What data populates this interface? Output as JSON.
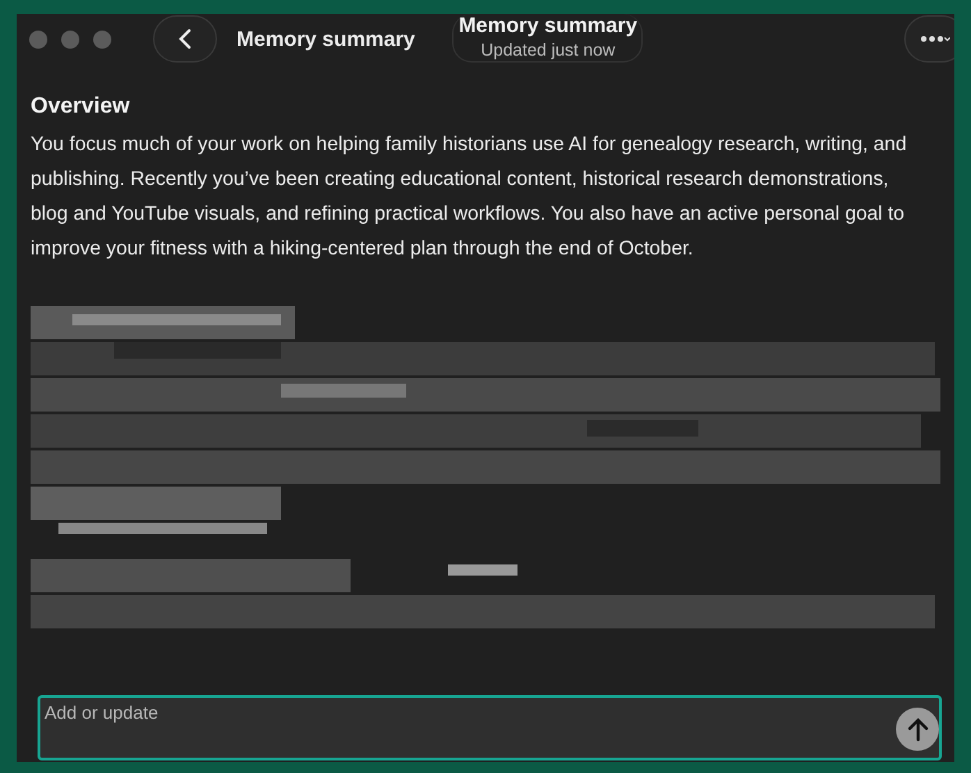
{
  "window": {
    "title": "Memory summary"
  },
  "header": {
    "title": "Memory summary",
    "subtitle": "Updated just now"
  },
  "overview": {
    "heading": "Overview",
    "text": "You focus much of your work on helping family historians use AI for genealogy research, writing, and publishing. Recently you’ve been creating educational content, historical research demonstrations, blog and YouTube visuals, and refining practical workflows. You also have an active personal goal to improve your fitness with a hiking-centered plan through the end of October."
  },
  "composer": {
    "placeholder": "Add or update"
  }
}
